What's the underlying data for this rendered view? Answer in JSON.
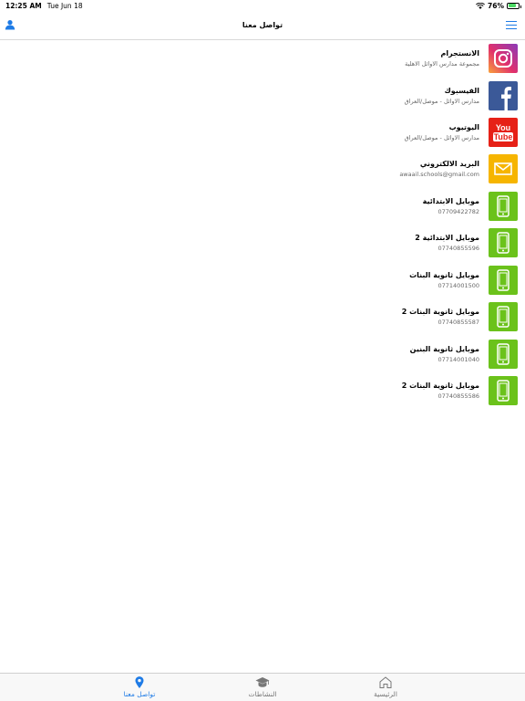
{
  "status_bar": {
    "time": "12:25 AM",
    "date": "Tue Jun 18",
    "battery": "76%",
    "battery_level": 0.76
  },
  "nav": {
    "title": "تواصل معنا"
  },
  "contacts": [
    {
      "title": "الانستجرام",
      "subtitle": "مجموعة مدارس الاوائل الاهلية",
      "icon": "instagram-icon",
      "color": "#e1306c"
    },
    {
      "title": "الفيسبوك",
      "subtitle": "مدارس الاوائل - موصل/العراق",
      "icon": "facebook-icon",
      "color": "#3b5998"
    },
    {
      "title": "اليوتيوب",
      "subtitle": "مدارس الاوائل - موصل/العراق",
      "icon": "youtube-icon",
      "color": "#e62117",
      "yt_top": "You",
      "yt_bottom": "Tube"
    },
    {
      "title": "البريد الالكتروني",
      "subtitle": "awaail.schools@gmail.com",
      "icon": "mail-icon",
      "color": "#f6b500"
    },
    {
      "title": "موبايل الابتدائية",
      "subtitle": "07709422782",
      "icon": "phone-icon",
      "color": "#6bc21b"
    },
    {
      "title": "موبايل الابتدائية 2",
      "subtitle": "07740855596",
      "icon": "phone-icon",
      "color": "#6bc21b"
    },
    {
      "title": "موبايل ثانوية البنات",
      "subtitle": "07714001500",
      "icon": "phone-icon",
      "color": "#6bc21b"
    },
    {
      "title": "موبايل ثانوية البنات 2",
      "subtitle": "07740855587",
      "icon": "phone-icon",
      "color": "#6bc21b"
    },
    {
      "title": "موبايل ثانوية البنين",
      "subtitle": "07714001040",
      "icon": "phone-icon",
      "color": "#6bc21b"
    },
    {
      "title": "موبايل ثانوية البنات 2",
      "subtitle": "07740855586",
      "icon": "phone-icon",
      "color": "#6bc21b"
    }
  ],
  "tabs": [
    {
      "label": "الرئيسية",
      "icon": "home-icon",
      "active": false
    },
    {
      "label": "النشاطات",
      "icon": "graduation-cap-icon",
      "active": false
    },
    {
      "label": "تواصل معنا",
      "icon": "location-pin-icon",
      "active": true
    }
  ],
  "colors": {
    "accent": "#1e7be6",
    "inactive": "#777777"
  }
}
